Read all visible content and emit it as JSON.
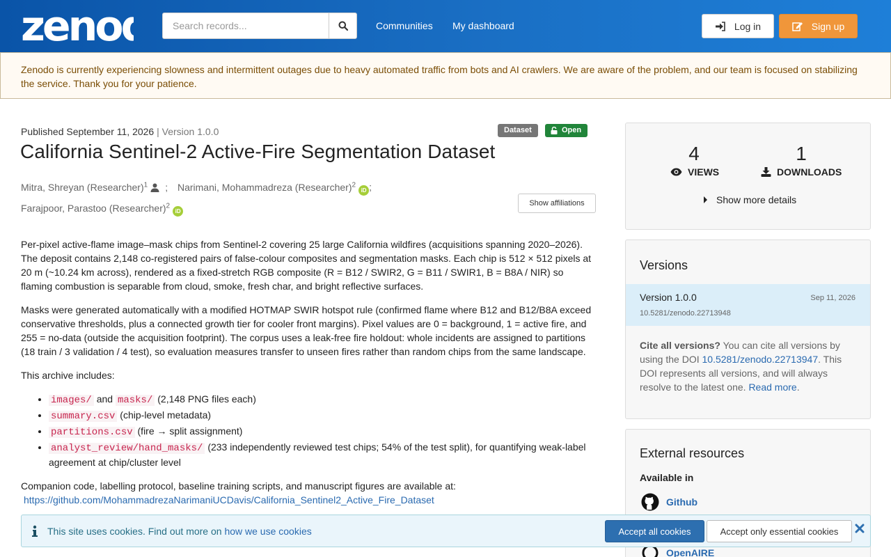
{
  "header": {
    "logo_text": "zenodo",
    "search_placeholder": "Search records...",
    "nav": [
      "Communities",
      "My dashboard"
    ],
    "login_label": "Log in",
    "signup_label": "Sign up",
    "signup_color": "#f0963a"
  },
  "banner": {
    "text": "Zenodo is currently experiencing slowness and intermittent outages due to heavy automated traffic from bots and AI crawlers. We are aware of the problem, and our team is focused on stabilizing the service. Thank you for your patience."
  },
  "record": {
    "published_label": "Published September 11, 2026",
    "version_label": "| Version 1.0.0",
    "badges": {
      "type": "Dataset",
      "access": "Open"
    },
    "title": "California Sentinel-2 Active-Fire Segmentation Dataset",
    "creators": [
      {
        "name": "Mitra, Shreyan (Researcher)",
        "aff": "1",
        "suffix": ";"
      },
      {
        "name": "Narimani, Mohammadreza (Researcher)",
        "aff": "2",
        "suffix": ";"
      },
      {
        "name": "Farajpoor, Parastoo (Researcher)",
        "aff": "2",
        "suffix": ""
      }
    ],
    "orcid_label": "iD",
    "show_affiliations": "Show affiliations",
    "description": {
      "p1": "Per-pixel active-flame image–mask chips from Sentinel-2 covering 25 large California wildfires (acquisitions spanning 2020–2026). The deposit contains 2,148 co-registered pairs of false-colour composites and segmentation masks. Each chip is 512 × 512 pixels at 20 m (~10.24 km across), rendered as a fixed-stretch RGB composite (R = B12 / SWIR2, G = B11 / SWIR1, B = B8A / NIR) so flaming combustion is separable from cloud, smoke, fresh char, and bright reflective surfaces.",
      "p2": "Masks were generated automatically with a modified HOTMAP SWIR hotspot rule (confirmed flame where B12 and B12/B8A exceed conservative thresholds, plus a connected growth tier for cooler front margins). Pixel values are 0 = background, 1 = active fire, and 255 = no-data (outside the acquisition footprint). The corpus uses a leak-free fire holdout: whole incidents are assigned to partitions (18 train / 3 validation / 4 test), so evaluation measures transfer to unseen fires rather than random chips from the same landscape.",
      "p3": "This archive includes:",
      "list": [
        {
          "code1": "images/",
          "mid": " and ",
          "code2": "masks/",
          "rest": " (2,148 PNG files each)"
        },
        {
          "code1": "summary.csv",
          "rest": " (chip-level metadata)"
        },
        {
          "code1": "partitions.csv",
          "rest": " (fire → split assignment)"
        },
        {
          "code1": "analyst_review/hand_masks/",
          "rest": " (233 independently reviewed test chips; 54% of the test split), for quantifying weak-label agreement at chip/cluster level"
        }
      ],
      "p4": "Companion code, labelling protocol, baseline training scripts, and manuscript figures are available at:",
      "link": "https://github.com/MohammadrezaNarimaniUCDavis/California_Sentinel2_Active_Fire_Dataset"
    }
  },
  "sidebar": {
    "stats": {
      "views": "4",
      "views_label": "VIEWS",
      "downloads": "1",
      "downloads_label": "DOWNLOADS",
      "more": "Show more details"
    },
    "versions": {
      "title": "Versions",
      "items": [
        {
          "name": "Version 1.0.0",
          "doi": "10.5281/zenodo.22713948",
          "date": "Sep 11, 2026"
        }
      ],
      "cite_bold": "Cite all versions?",
      "cite_text1": " You can cite all versions by using the DOI ",
      "cite_doi": "10.5281/zenodo.22713947",
      "cite_text2": ". This DOI represents all versions, and will always resolve to the latest one. ",
      "read_more": "Read more",
      "highlight_color": "#dbeef9"
    },
    "external": {
      "title": "External resources",
      "available": "Available in",
      "resources": [
        "Github",
        "OpenAIRE"
      ]
    }
  },
  "cookie": {
    "text": "This site uses cookies. Find out more on ",
    "link": "how we use cookies",
    "accept_all": "Accept all cookies",
    "accept_essential": "Accept only essential cookies"
  },
  "colors": {
    "header_start": "#0a54a8",
    "header_end": "#1e7fd8",
    "link": "#2a6ab0",
    "open_badge": "#21853a",
    "dataset_badge": "#767676",
    "code": "#c7254e"
  }
}
